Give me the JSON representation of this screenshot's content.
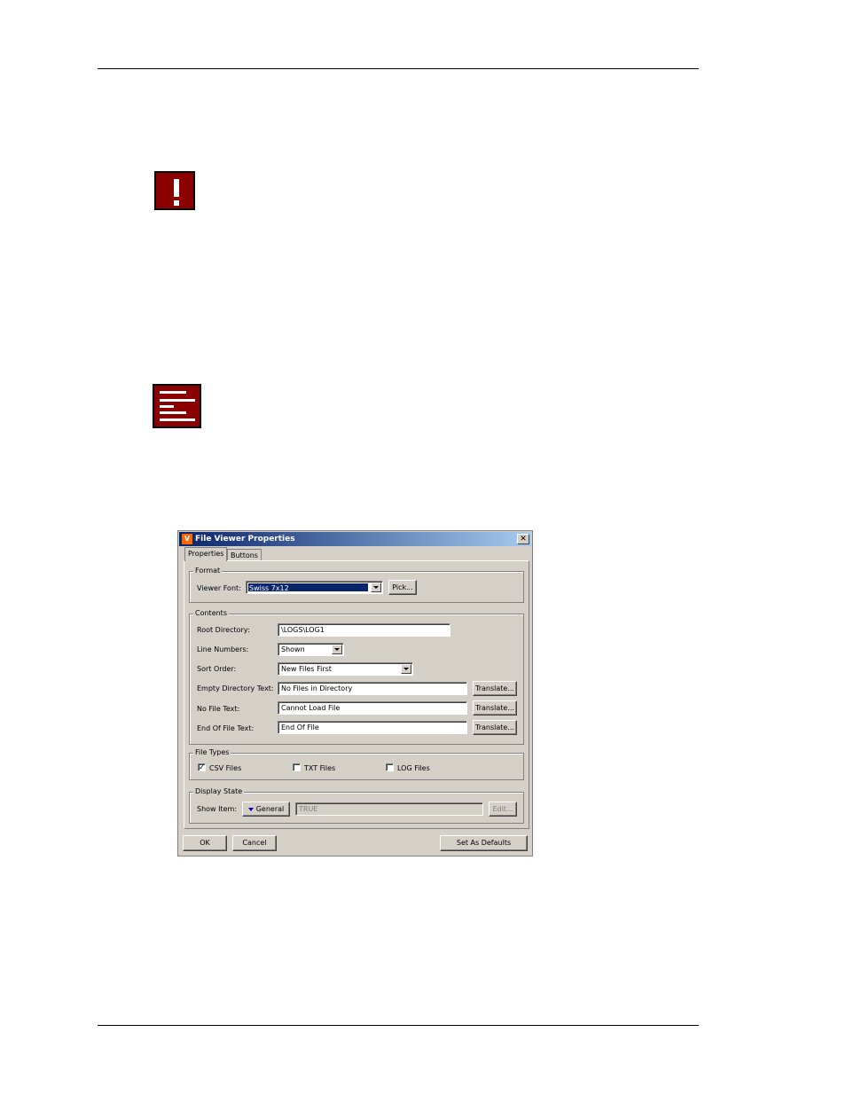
{
  "dialog": {
    "title": "File Viewer Properties",
    "close_glyph": "✕",
    "logo_glyph": "V",
    "tabs": [
      {
        "label": "Properties",
        "active": true
      },
      {
        "label": "Buttons",
        "active": false
      }
    ],
    "format": {
      "group_label": "Format",
      "viewer_font_label": "Viewer Font:",
      "viewer_font_value": "Swiss 7x12",
      "pick_button": "Pick..."
    },
    "contents": {
      "group_label": "Contents",
      "root_directory_label": "Root Directory:",
      "root_directory_value": "\\LOGS\\LOG1",
      "line_numbers_label": "Line Numbers:",
      "line_numbers_value": "Shown",
      "sort_order_label": "Sort Order:",
      "sort_order_value": "New Files First",
      "empty_dir_label": "Empty Directory Text:",
      "empty_dir_value": "No Files in Directory",
      "no_file_label": "No File Text:",
      "no_file_value": "Cannot Load File",
      "eof_label": "End Of File Text:",
      "eof_value": "End Of File",
      "translate_button": "Translate..."
    },
    "file_types": {
      "group_label": "File Types",
      "csv_label": "CSV Files",
      "csv_checked": true,
      "txt_label": "TXT Files",
      "txt_checked": false,
      "log_label": "LOG Files",
      "log_checked": false,
      "check_glyph": "✓"
    },
    "display_state": {
      "group_label": "Display State",
      "show_item_label": "Show Item:",
      "mode_button": "General",
      "value": "TRUE",
      "edit_button": "Edit..."
    },
    "footer": {
      "ok_button": "OK",
      "cancel_button": "Cancel",
      "defaults_button": "Set As Defaults"
    }
  }
}
